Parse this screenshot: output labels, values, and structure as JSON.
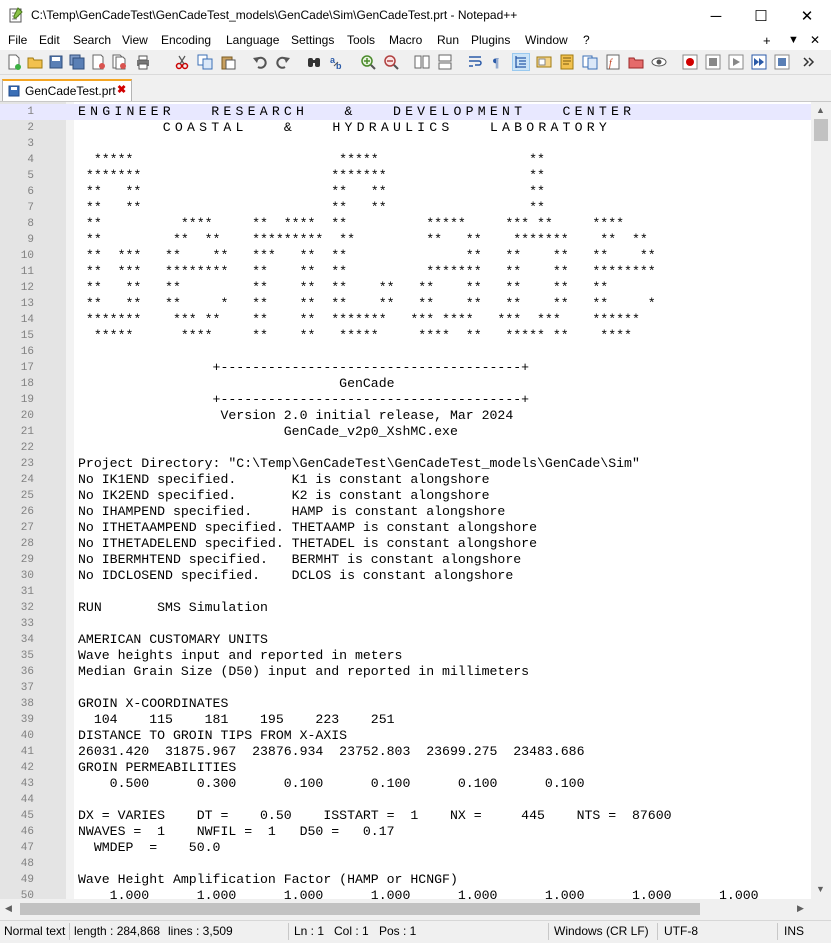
{
  "window": {
    "title": "C:\\Temp\\GenCadeTest\\GenCadeTest_models\\GenCade\\Sim\\GenCadeTest.prt - Notepad++",
    "minimize": "─",
    "maximize": "☐",
    "close": "✕"
  },
  "menu": {
    "items": [
      "File",
      "Edit",
      "Search",
      "View",
      "Encoding",
      "Language",
      "Settings",
      "Tools",
      "Macro",
      "Run",
      "Plugins",
      "Window",
      "?"
    ],
    "right": [
      "+",
      "▼",
      "✕"
    ]
  },
  "toolbar": {
    "icons": [
      "new-file-icon",
      "open-file-icon",
      "save-icon",
      "save-all-icon",
      "close-icon",
      "close-all-icon",
      "print-icon",
      "cut-icon",
      "copy-icon",
      "paste-icon",
      "undo-icon",
      "redo-icon",
      "find-icon",
      "replace-icon",
      "zoom-in-icon",
      "zoom-out-icon",
      "sync-vertical-icon",
      "sync-horizontal-icon",
      "word-wrap-icon",
      "show-all-chars-icon",
      "indent-guide-icon",
      "doc-map-icon",
      "function-list-icon",
      "folder-workspace-icon",
      "doc-list-icon",
      "monitoring-icon",
      "record-macro-icon",
      "stop-record-icon",
      "play-macro-icon",
      "run-macro-multiple-icon",
      "save-macro-icon"
    ]
  },
  "tab": {
    "label": "GenCadeTest.prt",
    "close": "✖"
  },
  "editor": {
    "lines": [
      {
        "n": "1",
        "t": "ENGINEER   RESEARCH   &   DEVELOPMENT   CENTER"
      },
      {
        "n": "2",
        "t": "       COASTAL   &   HYDRAULICS   LABORATORY"
      },
      {
        "n": "3",
        "t": ""
      },
      {
        "n": "4",
        "t": "  *****                          *****                   **"
      },
      {
        "n": "5",
        "t": " *******                        *******                  **"
      },
      {
        "n": "6",
        "t": " **   **                        **   **                  **"
      },
      {
        "n": "7",
        "t": " **   **                        **   **                  **"
      },
      {
        "n": "8",
        "t": " **          ****     **  ****  **          *****     *** **     ****"
      },
      {
        "n": "9",
        "t": " **         **  **    *********  **         **   **    *******    **  **"
      },
      {
        "n": "10",
        "t": " **  ***   **    **   ***   **  **               **   **    **   **    **"
      },
      {
        "n": "11",
        "t": " **  ***   ********   **    **  **          *******   **    **   ********"
      },
      {
        "n": "12",
        "t": " **   **   **         **    **  **    **   **    **   **    **   **"
      },
      {
        "n": "13",
        "t": " **   **   **     *   **    **  **    **   **    **   **    **   **     *"
      },
      {
        "n": "14",
        "t": " *******    *** **    **    **  *******   *** ****   ***  ***    ******"
      },
      {
        "n": "15",
        "t": "  *****      ****     **    **   *****     ****  **   ***** **    ****"
      },
      {
        "n": "16",
        "t": ""
      },
      {
        "n": "17",
        "t": "                 +--------------------------------------+"
      },
      {
        "n": "18",
        "t": "                                 GenCade"
      },
      {
        "n": "19",
        "t": "                 +--------------------------------------+"
      },
      {
        "n": "20",
        "t": "                  Version 2.0 initial release, Mar 2024"
      },
      {
        "n": "21",
        "t": "                          GenCade_v2p0_XshMC.exe"
      },
      {
        "n": "22",
        "t": ""
      },
      {
        "n": "23",
        "t": "Project Directory: \"C:\\Temp\\GenCadeTest\\GenCadeTest_models\\GenCade\\Sim\""
      },
      {
        "n": "24",
        "t": "No IK1END specified.       K1 is constant alongshore"
      },
      {
        "n": "25",
        "t": "No IK2END specified.       K2 is constant alongshore"
      },
      {
        "n": "26",
        "t": "No IHAMPEND specified.     HAMP is constant alongshore"
      },
      {
        "n": "27",
        "t": "No ITHETAAMPEND specified. THETAAMP is constant alongshore"
      },
      {
        "n": "28",
        "t": "No ITHETADELEND specified. THETADEL is constant alongshore"
      },
      {
        "n": "29",
        "t": "No IBERMHTEND specified.   BERMHT is constant alongshore"
      },
      {
        "n": "30",
        "t": "No IDCLOSEND specified.    DCLOS is constant alongshore"
      },
      {
        "n": "31",
        "t": ""
      },
      {
        "n": "32",
        "t": "RUN       SMS Simulation"
      },
      {
        "n": "33",
        "t": ""
      },
      {
        "n": "34",
        "t": "AMERICAN CUSTOMARY UNITS"
      },
      {
        "n": "35",
        "t": "Wave heights input and reported in meters"
      },
      {
        "n": "36",
        "t": "Median Grain Size (D50) input and reported in millimeters"
      },
      {
        "n": "37",
        "t": ""
      },
      {
        "n": "38",
        "t": "GROIN X-COORDINATES"
      },
      {
        "n": "39",
        "t": "  104    115    181    195    223    251"
      },
      {
        "n": "40",
        "t": "DISTANCE TO GROIN TIPS FROM X-AXIS"
      },
      {
        "n": "41",
        "t": "26031.420  31875.967  23876.934  23752.803  23699.275  23483.686"
      },
      {
        "n": "42",
        "t": "GROIN PERMEABILITIES"
      },
      {
        "n": "43",
        "t": "    0.500      0.300      0.100      0.100      0.100      0.100"
      },
      {
        "n": "44",
        "t": ""
      },
      {
        "n": "45",
        "t": "DX = VARIES    DT =    0.50    ISSTART =  1    NX =     445    NTS =  87600"
      },
      {
        "n": "46",
        "t": "NWAVES =  1    NWFIL =  1   D50 =   0.17"
      },
      {
        "n": "47",
        "t": "  WMDEP  =    50.0"
      },
      {
        "n": "48",
        "t": ""
      },
      {
        "n": "49",
        "t": "Wave Height Amplification Factor (HAMP or HCNGF)"
      },
      {
        "n": "50",
        "t": "    1.000      1.000      1.000      1.000      1.000      1.000      1.000      1.000"
      }
    ]
  },
  "status": {
    "type": "Normal text",
    "length": "length : 284,868",
    "lines": "lines : 3,509",
    "ln": "Ln : 1",
    "col": "Col : 1",
    "pos": "Pos : 1",
    "eol": "Windows (CR LF)",
    "encoding": "UTF-8",
    "mode": "INS"
  }
}
